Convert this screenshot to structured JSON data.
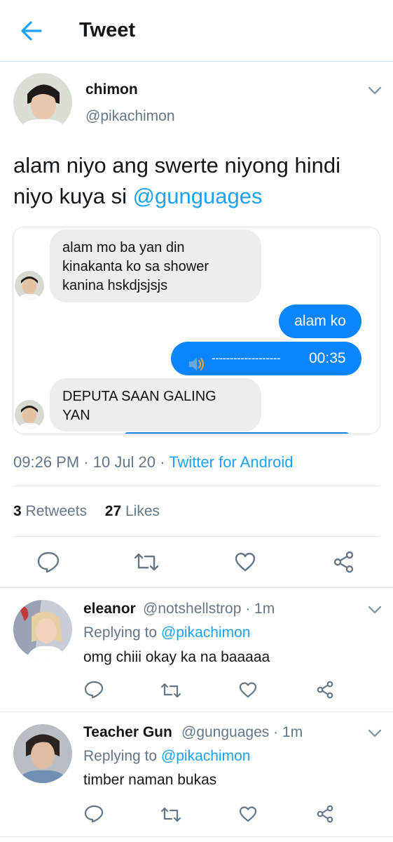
{
  "header": {
    "title": "Tweet",
    "accent": "#1da1f2"
  },
  "tweet": {
    "author_name": "chimon",
    "author_handle": "@pikachimon",
    "text_before": "alam niyo ang swerte niyong hindi niyo kuya si ",
    "mention": "@gunguages",
    "time": "09:26 PM",
    "date": "10 Jul 20",
    "source": "Twitter for Android",
    "retweets_count": "3",
    "retweets_label": "Retweets",
    "likes_count": "27",
    "likes_label": "Likes"
  },
  "chat": {
    "msg1_line1": "alam mo ba yan din",
    "msg1_line2": "kinakanta ko sa shower",
    "msg1_line3": "kanina hskdjsjsjs",
    "msg2": "alam ko",
    "voice_wave": "-------------------",
    "voice_duration": "00:35",
    "msg3_line1": "DEPUTA SAAN GALING",
    "msg3_line2": "YAN"
  },
  "replies": [
    {
      "name": "eleanor",
      "handle": "@notshellstrop · 1m",
      "replying_prefix": "Replying to ",
      "replying_to": "@pikachimon",
      "text": "omg chiii okay ka na baaaaa"
    },
    {
      "name": "Teacher Gun",
      "handle": "@gunguages · 1m",
      "replying_prefix": "Replying to ",
      "replying_to": "@pikachimon",
      "text": "timber naman bukas"
    }
  ]
}
